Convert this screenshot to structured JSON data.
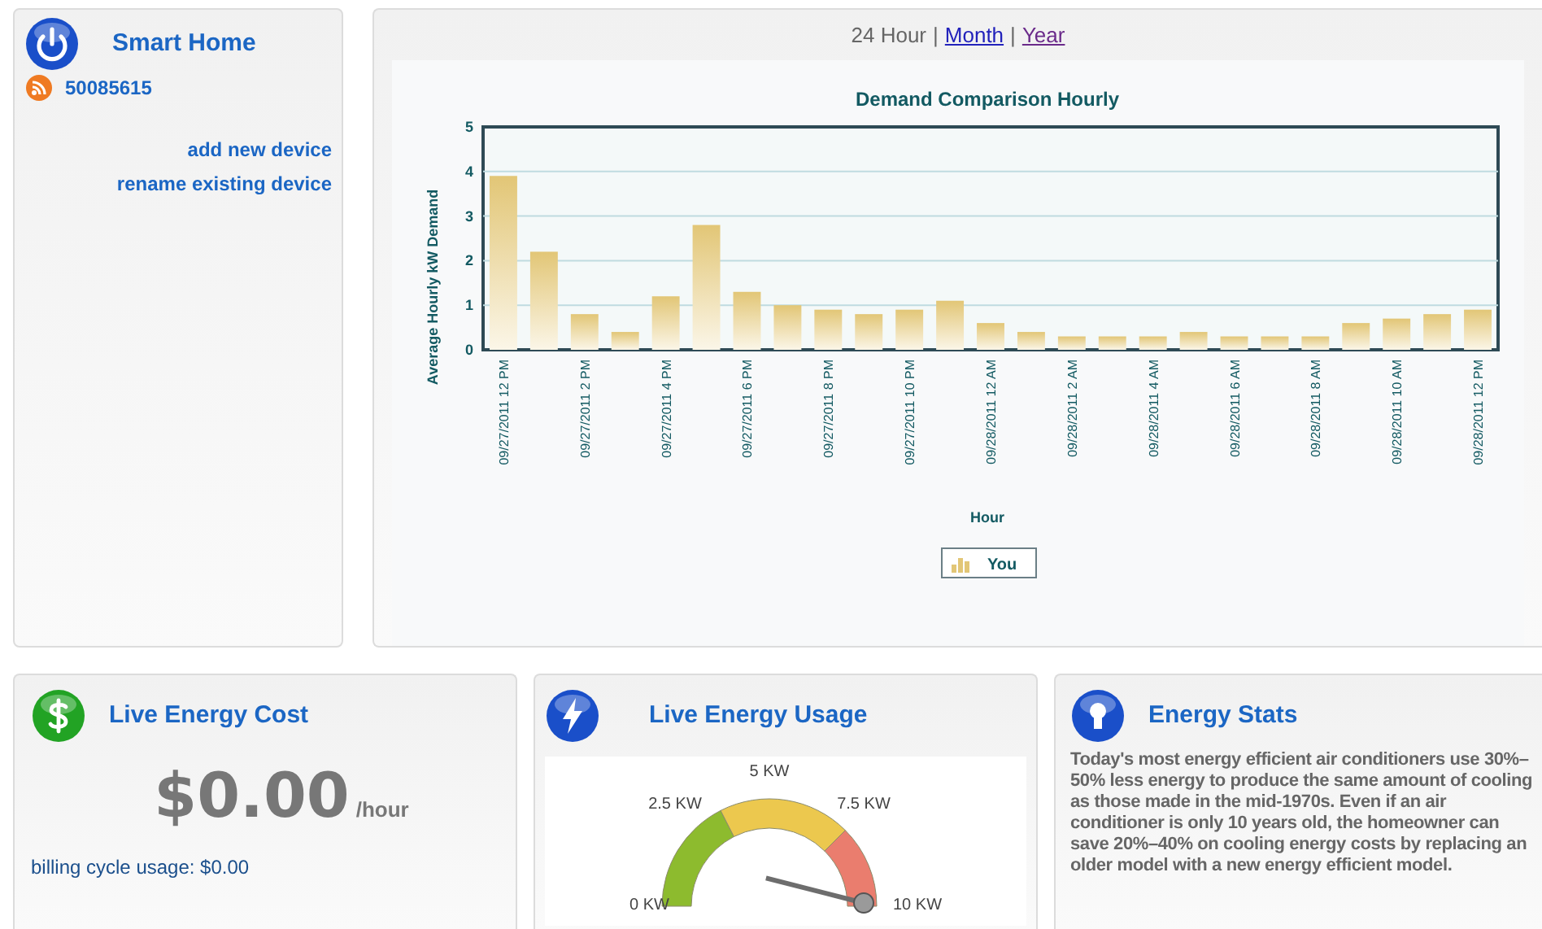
{
  "smart_home": {
    "title": "Smart Home",
    "account": "50085615",
    "links": [
      "add new device",
      "rename existing device"
    ]
  },
  "chart_panel": {
    "range_tabs": [
      {
        "label": "24 Hour",
        "selected": true
      },
      {
        "label": "Month",
        "selected": false
      },
      {
        "label": "Year",
        "selected": false
      }
    ],
    "separator": "|",
    "chart_data": {
      "type": "bar",
      "title": "Demand Comparison Hourly",
      "xlabel": "Hour",
      "ylabel": "Average Hourly kW Demand",
      "ylim": [
        0,
        5
      ],
      "yticks": [
        0,
        1,
        2,
        3,
        4,
        5
      ],
      "grid": true,
      "categories": [
        "09/27/2011 12 PM",
        null,
        "09/27/2011 2 PM",
        null,
        "09/27/2011 4 PM",
        null,
        "09/27/2011 6 PM",
        null,
        "09/27/2011 8 PM",
        null,
        "09/27/2011 10 PM",
        null,
        "09/28/2011 12 AM",
        null,
        "09/28/2011 2 AM",
        null,
        "09/28/2011 4 AM",
        null,
        "09/28/2011 6 AM",
        null,
        "09/28/2011 8 AM",
        null,
        "09/28/2011 10 AM",
        null,
        "09/28/2011 12 PM"
      ],
      "series": [
        {
          "name": "You",
          "color": "#e2c676",
          "values": [
            3.9,
            2.2,
            0.8,
            0.4,
            1.2,
            2.8,
            1.3,
            1.0,
            0.9,
            0.8,
            0.9,
            1.1,
            0.6,
            0.4,
            0.3,
            0.3,
            0.3,
            0.4,
            0.3,
            0.3,
            0.3,
            0.6,
            0.7,
            0.8,
            0.9
          ]
        }
      ]
    }
  },
  "live_energy_cost": {
    "title": "Live Energy Cost",
    "amount": "$0.00",
    "unit": "/hour",
    "billing": "billing cycle usage: $0.00"
  },
  "live_energy_usage": {
    "title": "Live Energy Usage",
    "gauge": {
      "labels": [
        "0 KW",
        "2.5 KW",
        "5 KW",
        "7.5 KW",
        "10 KW"
      ]
    }
  },
  "energy_stats": {
    "title": "Energy Stats",
    "text": "Today's most energy efficient air conditioners use 30%–50% less energy to produce the same amount of cooling as those made in the mid-1970s. Even if an air conditioner is only 10 years old, the homeowner can save 20%–40% on cooling energy costs by replacing an older model with a new energy efficient model."
  }
}
